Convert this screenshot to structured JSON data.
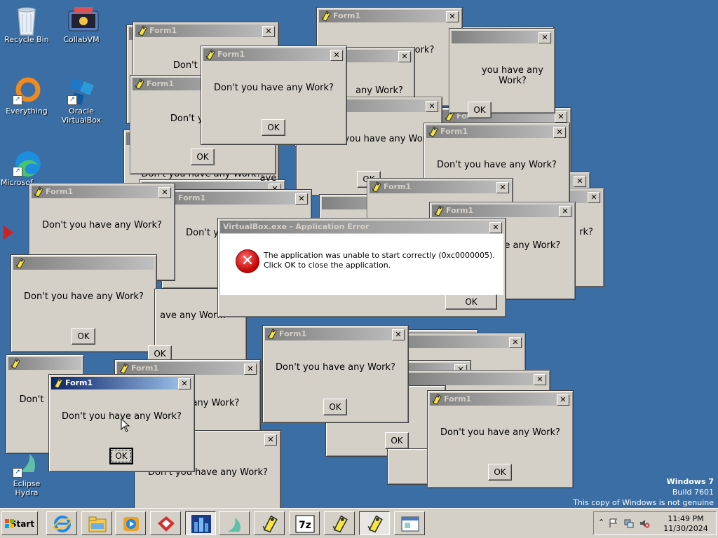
{
  "desktop_icons": [
    {
      "label": "Recycle Bin"
    },
    {
      "label": "CollabVM"
    },
    {
      "label": "Everything"
    },
    {
      "label": "Oracle VirtualBox"
    },
    {
      "label": "Microsof"
    },
    {
      "label": "Eclipse Hydra"
    }
  ],
  "form": {
    "title": "Form1",
    "message": "Don't you have any Work?",
    "ok_label": "OK",
    "close_glyph": "✕"
  },
  "partial_texts": {
    "dont_you_ha": "Don't you ha",
    "any_work_q": "any Work?",
    "dont_you_have_any_wo": "Don't you have any Wo",
    "dont_you_have_any_wor": "Don't you have any Wor",
    "dont": "Don't",
    "work_q": "Work?",
    "rk_q": "rk?",
    "ave": "ave",
    "we_have_any_work": "ave any Work?",
    "you_have_any_work": "you have any Work?",
    "dont_yo": "Don't yo",
    "ork": "ork?",
    "dot_truncated": "Don't you have any Work?"
  },
  "error_dialog": {
    "title": "VirtualBox.exe - Application Error",
    "message": "The application was unable to start correctly (0xc0000005). Click OK to close the application.",
    "ok_label": "OK"
  },
  "watermark": {
    "line1": "Windows 7",
    "line2": "Build 7601",
    "line3": "This copy of Windows is not genuine"
  },
  "taskbar": {
    "start_label": "Start",
    "clock_time": "11:49 PM",
    "clock_date": "11/30/2024"
  },
  "taskbar_apps": [
    "internet-explorer-icon",
    "file-explorer-icon",
    "media-player-icon",
    "red-app-icon",
    "city-app-icon",
    "eclipse-hydra-icon",
    "form-app-icon",
    "7zip-icon",
    "form-app-icon",
    "form-app-icon",
    "window-app-icon"
  ],
  "colors": {
    "desktop": "#3a6ea5",
    "inactive_title": "#808080",
    "active_title": "#0a246a",
    "error_icon": "#c00000"
  }
}
